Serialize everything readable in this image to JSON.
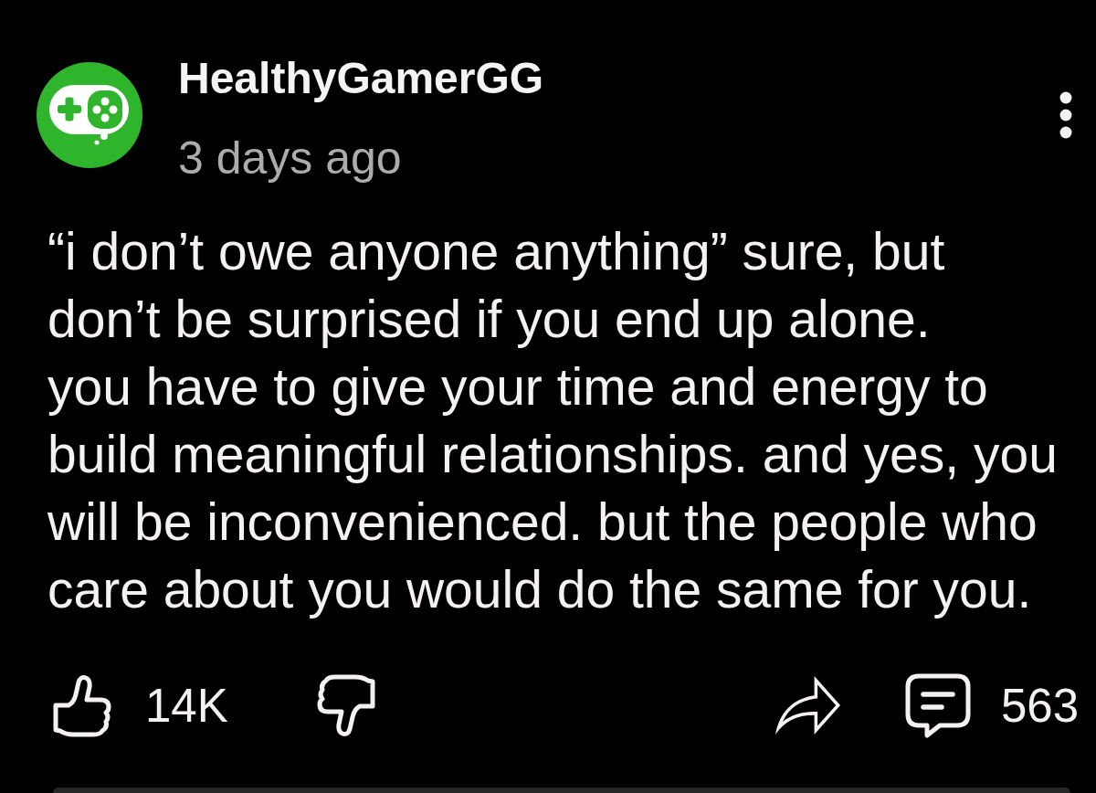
{
  "post": {
    "author": {
      "name": "HealthyGamerGG",
      "posted": "3 days ago"
    },
    "paragraphs": [
      "“i don’t owe anyone anything” sure, but don’t be surprised if you end up alone.",
      "you have to give your time and energy to build meaningful relationships. and yes, you will be inconvenienced. but the people who care about you would do the same for you."
    ]
  },
  "actions": [
    {
      "kind": "like",
      "count": "14K"
    },
    {
      "kind": "dislike"
    },
    {
      "kind": "share"
    },
    {
      "kind": "comment",
      "count": "563"
    }
  ]
}
